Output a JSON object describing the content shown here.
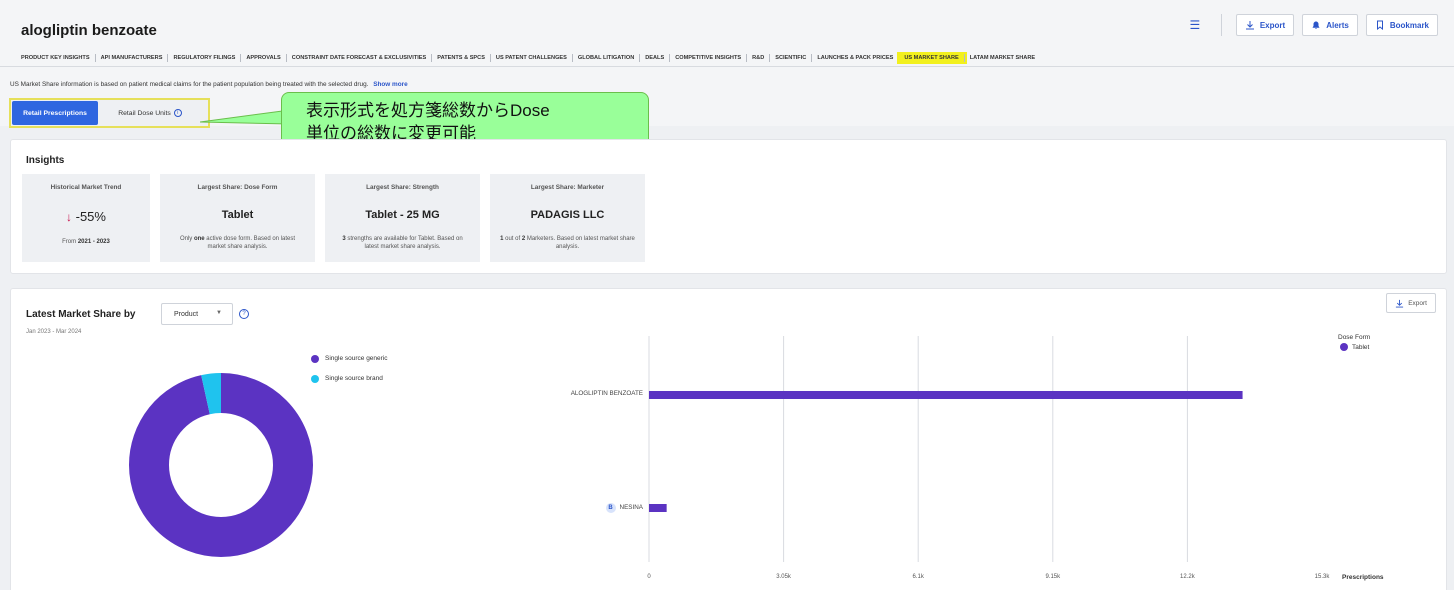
{
  "header": {
    "drug_title": "alogliptin benzoate",
    "actions": {
      "export": "Export",
      "alerts": "Alerts",
      "bookmark": "Bookmark"
    }
  },
  "tabs": [
    {
      "label": "PRODUCT KEY INSIGHTS",
      "active": false
    },
    {
      "label": "API MANUFACTURERS",
      "active": false
    },
    {
      "label": "REGULATORY FILINGS",
      "active": false
    },
    {
      "label": "APPROVALS",
      "active": false
    },
    {
      "label": "CONSTRAINT DATE FORECAST & EXCLUSIVITIES",
      "active": false
    },
    {
      "label": "PATENTS & SPCS",
      "active": false
    },
    {
      "label": "US PATENT CHALLENGES",
      "active": false
    },
    {
      "label": "GLOBAL LITIGATION",
      "active": false
    },
    {
      "label": "DEALS",
      "active": false
    },
    {
      "label": "COMPETITIVE INSIGHTS",
      "active": false
    },
    {
      "label": "R&D",
      "active": false
    },
    {
      "label": "SCIENTIFIC",
      "active": false
    },
    {
      "label": "LAUNCHES & PACK PRICES",
      "active": false
    },
    {
      "label": "US MARKET SHARE",
      "active": true
    },
    {
      "label": "LATAM MARKET SHARE",
      "active": false
    }
  ],
  "info": {
    "text": "US Market Share information is based on patient medical claims for the patient population being treated with the selected drug.",
    "link": "Show more"
  },
  "mode_toggle": {
    "selected": "Retail Prescriptions",
    "other": "Retail Dose Units",
    "info_glyph": "i"
  },
  "callout": {
    "line1": "表示形式を処方箋総数からDose",
    "line2": "単位の総数に変更可能"
  },
  "insights": {
    "title": "Insights",
    "tiles": [
      {
        "heading": "Historical Market Trend",
        "value": "-55%",
        "arrow": "↓",
        "desc_prefix": "From ",
        "desc_bold": "2021 - 2023",
        "desc_suffix": ""
      },
      {
        "heading": "Largest Share: Dose Form",
        "value": "Tablet",
        "desc_prefix": "Only ",
        "desc_bold": "one",
        "desc_suffix": " active dose form. Based on latest market share analysis."
      },
      {
        "heading": "Largest Share: Strength",
        "value": "Tablet - 25 MG",
        "desc_prefix": "",
        "desc_bold": "3",
        "desc_suffix": " strengths are available for Tablet. Based on latest market share analysis."
      },
      {
        "heading": "Largest Share: Marketer",
        "value": "PADAGIS LLC",
        "desc_prefix": "",
        "desc_bold": "1",
        "desc_suffix_mid": " out of ",
        "desc_bold2": "2",
        "desc_suffix": " Marketers. Based on latest market share analysis."
      }
    ]
  },
  "market_share": {
    "title": "Latest Market Share by",
    "selector": "Product",
    "help_glyph": "?",
    "date_range": "Jan 2023 - Mar 2024",
    "export": "Export"
  },
  "chart_data": [
    {
      "type": "pie",
      "series": [
        {
          "name": "Single source generic",
          "value": 96.5,
          "color": "#5b33c2"
        },
        {
          "name": "Single source brand",
          "value": 3.5,
          "color": "#1fc3ee"
        }
      ]
    },
    {
      "type": "bar",
      "orientation": "horizontal",
      "categories": [
        "ALOGLIPTIN BENZOATE",
        "NESINA"
      ],
      "category_badges": [
        "",
        "B"
      ],
      "values": [
        13450,
        400
      ],
      "xlabel": "Prescriptions",
      "xticks": [
        "0",
        "3.05k",
        "6.1k",
        "9.15k",
        "12.2k",
        "15.3k"
      ],
      "xtick_values": [
        0,
        3050,
        6100,
        9150,
        12200,
        15250
      ],
      "xlim": [
        0,
        15250
      ],
      "legend_title": "Dose Form",
      "legend": [
        {
          "name": "Tablet",
          "color": "#5b33c2"
        }
      ],
      "color": "#5b33c2"
    }
  ]
}
